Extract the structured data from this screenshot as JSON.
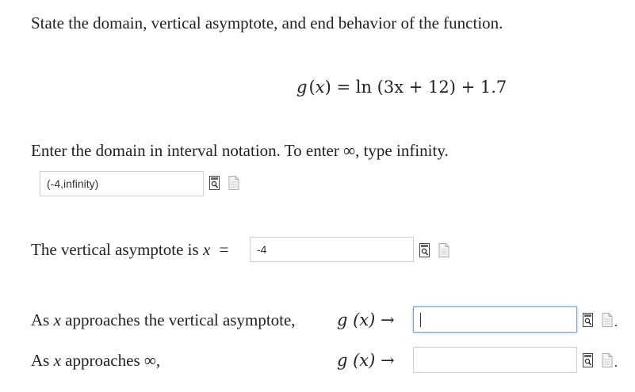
{
  "prompt": "State the domain, vertical asymptote, and end behavior of the function.",
  "function": {
    "lhs": "g",
    "var": "x",
    "rhs_text": "= ln (3x + 12) + 1.7"
  },
  "domain_question": {
    "label": "Enter the domain in interval notation. To enter ∞, type infinity.",
    "value": "(-4,infinity)"
  },
  "asymptote_question": {
    "label_prefix": "The vertical asymptote is",
    "var": "x",
    "eq": "=",
    "value": "-4"
  },
  "end_behavior_1": {
    "label_prefix": "As",
    "var": "x",
    "label_suffix": "approaches the vertical asymptote,",
    "func": "g (x) →",
    "value": ""
  },
  "end_behavior_2": {
    "label_prefix": "As",
    "var": "x",
    "label_suffix": "approaches ∞,",
    "func": "g (x) →",
    "value": ""
  },
  "icons": {
    "preview": "preview-icon",
    "file": "file-icon"
  },
  "colors": {
    "focus_border": "#6aa7e0",
    "input_border": "#cfcfcf"
  }
}
